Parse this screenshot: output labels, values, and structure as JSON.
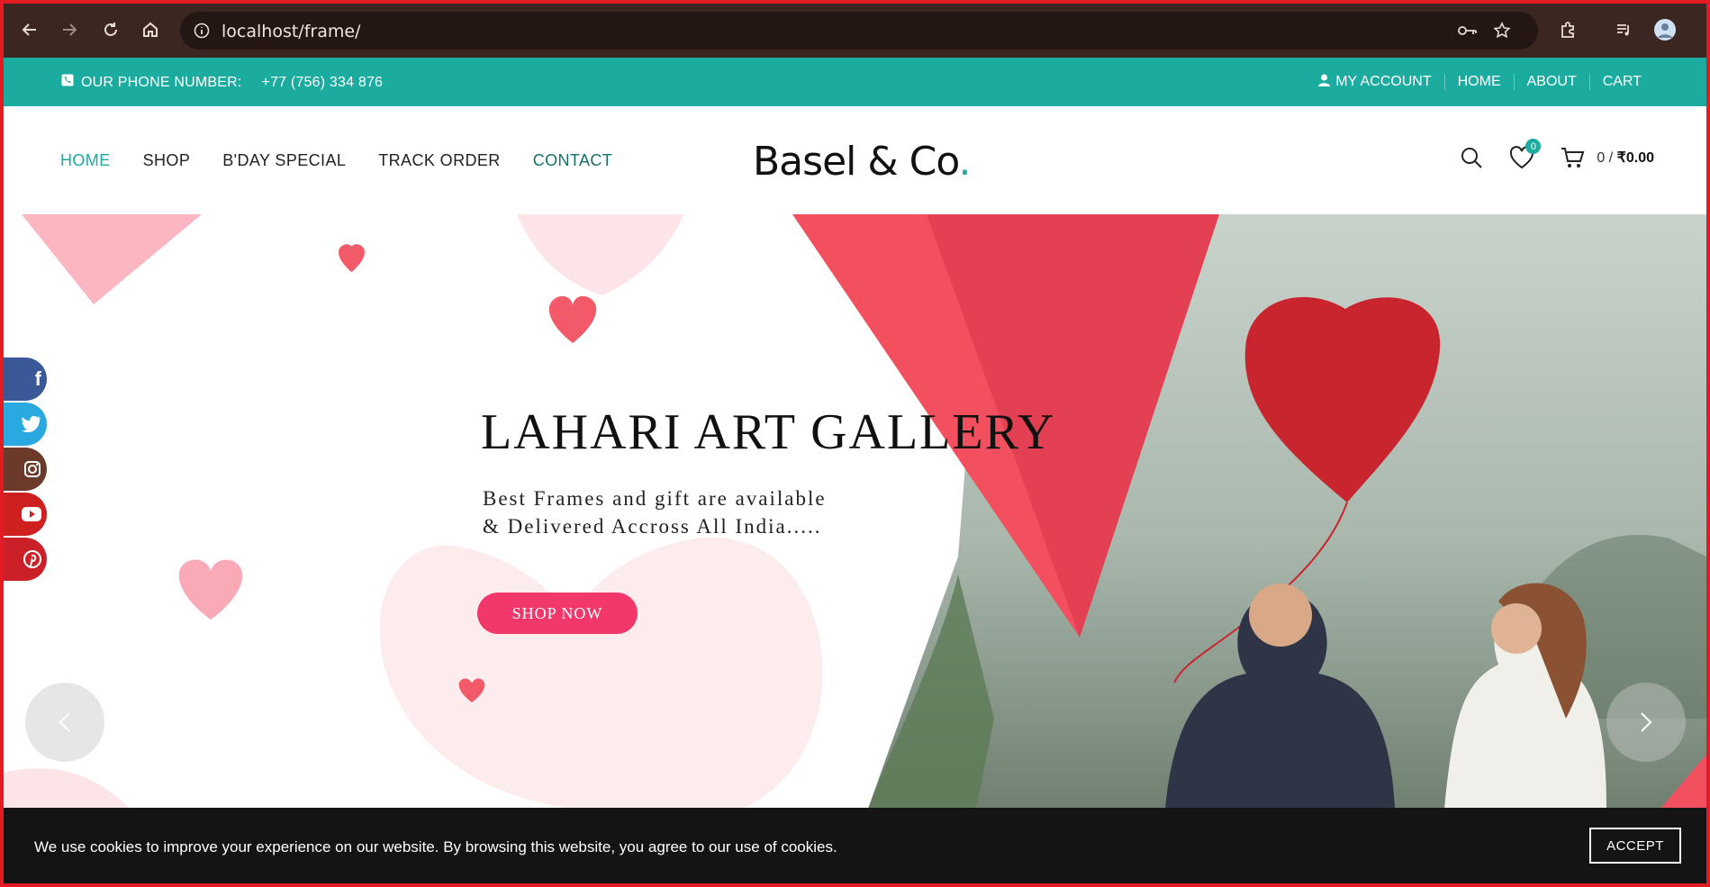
{
  "browser": {
    "url": "localhost/frame/"
  },
  "topbar": {
    "phone_label": "OUR PHONE NUMBER:",
    "phone_number": "+77 (756) 334 876",
    "links": [
      "MY ACCOUNT",
      "HOME",
      "ABOUT",
      "CART"
    ]
  },
  "nav": {
    "items": [
      "HOME",
      "SHOP",
      "B'DAY SPECIAL",
      "TRACK ORDER",
      "CONTACT"
    ],
    "active": "HOME"
  },
  "logo": {
    "text": "Basel & Co",
    "dot": "."
  },
  "header": {
    "wishlist_count": "0",
    "cart_count": "0 /",
    "cart_total": "₹0.00"
  },
  "hero": {
    "title": "LAHARI ART GALLERY",
    "subtitle": "Best Frames and gift are available\n& Delivered Accross All India.....",
    "button": "SHOP NOW"
  },
  "social": [
    "facebook-icon",
    "twitter-icon",
    "instagram-icon",
    "youtube-icon",
    "pinterest-icon"
  ],
  "cookie": {
    "message": "We use cookies to improve your experience on our website. By browsing this website, you agree to our use of cookies.",
    "accept": "ACCEPT"
  },
  "colors": {
    "teal": "#1bab9f",
    "chrome": "#3b2621",
    "pink_button": "#f2376b",
    "triangle_red": "#f2505f",
    "cookie_bg": "#141414"
  }
}
